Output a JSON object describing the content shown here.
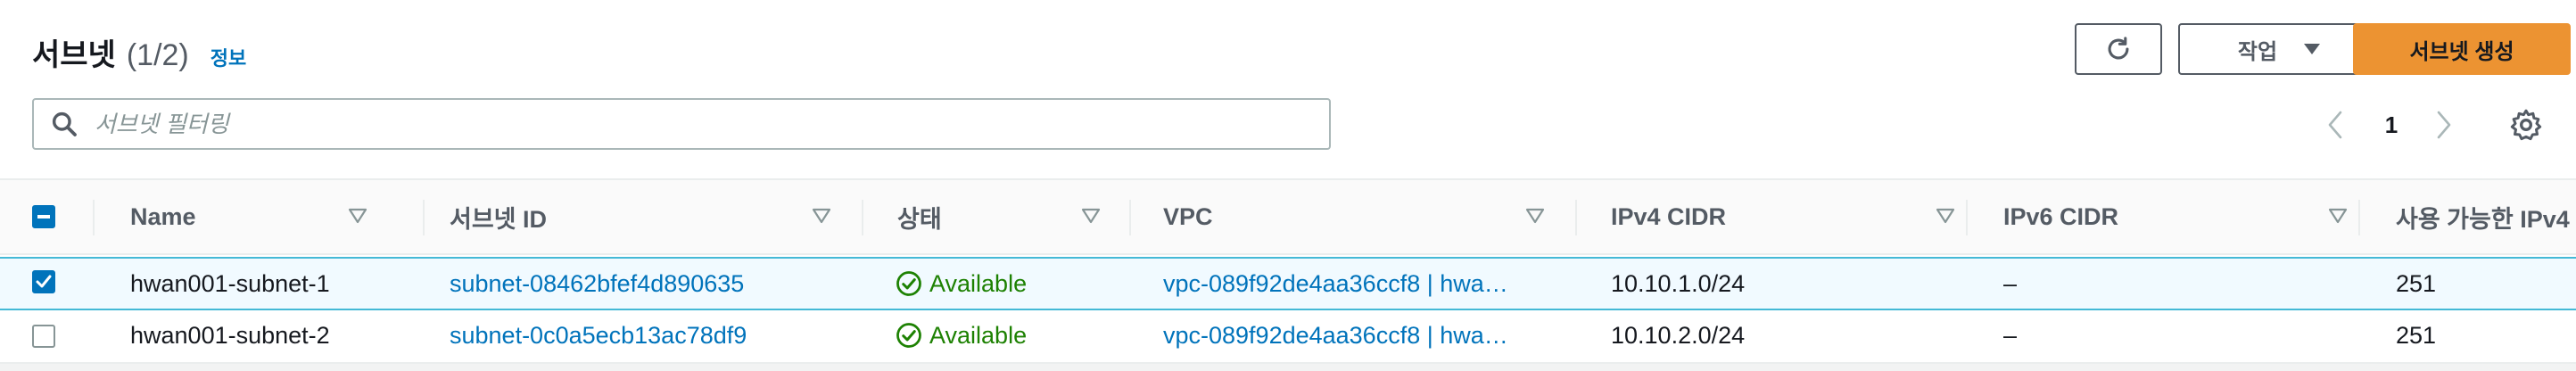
{
  "header": {
    "title": "서브넷",
    "count": "(1/2)",
    "info_link": "정보",
    "actions_label": "작업",
    "create_label": "서브넷 생성"
  },
  "search": {
    "placeholder": "서브넷 필터링",
    "value": ""
  },
  "pagination": {
    "current_page": "1"
  },
  "table": {
    "columns": [
      "Name",
      "서브넷 ID",
      "상태",
      "VPC",
      "IPv4 CIDR",
      "IPv6 CIDR",
      "사용 가능한 IPv4"
    ],
    "rows": [
      {
        "selected": true,
        "name": "hwan001-subnet-1",
        "subnet_id": "subnet-08462bfef4d890635",
        "status": "Available",
        "vpc": "vpc-089f92de4aa36ccf8 | hwa…",
        "ipv4_cidr": "10.10.1.0/24",
        "ipv6_cidr": "–",
        "available_ipv4": "251"
      },
      {
        "selected": false,
        "name": "hwan001-subnet-2",
        "subnet_id": "subnet-0c0a5ecb13ac78df9",
        "status": "Available",
        "vpc": "vpc-089f92de4aa36ccf8 | hwa…",
        "ipv4_cidr": "10.10.2.0/24",
        "ipv6_cidr": "–",
        "available_ipv4": "251"
      }
    ]
  },
  "colors": {
    "primary_button": "#ec9332",
    "link": "#0073bb",
    "status_ok": "#1d8102",
    "selected_row_border": "#44b9d6",
    "selected_row_bg": "#f1faff"
  },
  "icons": {
    "refresh": "refresh-icon",
    "dropdown": "caret-down-icon",
    "search": "search-icon",
    "prev": "chevron-left-icon",
    "next": "chevron-right-icon",
    "settings": "gear-icon",
    "sort": "sort-triangle-icon",
    "status": "check-circle-icon"
  }
}
